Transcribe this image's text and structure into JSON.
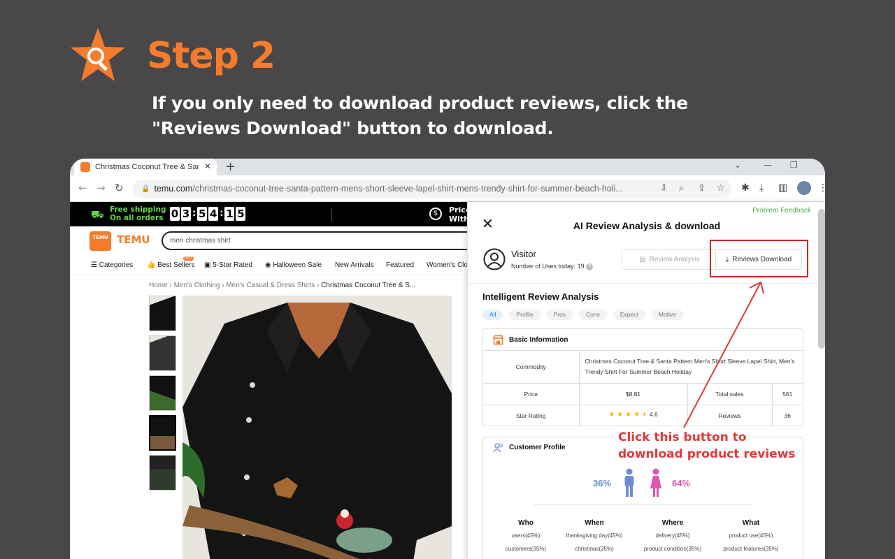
{
  "hero": {
    "step_label": "Step 2",
    "description": "If you only need to download product reviews, click the \"Reviews Download\" button to download."
  },
  "browser": {
    "tab_title": "Christmas Coconut Tree & Santa",
    "url_domain": "temu.com",
    "url_path": "/christmas-coconut-tree-santa-pattern-mens-short-sleeve-lapel-shirt-mens-trendy-shirt-for-summer-beach-holi..."
  },
  "temu": {
    "promo_line1": "Free shipping",
    "promo_line2": "On all orders",
    "timer_digits": [
      "0",
      "3",
      "5",
      "4",
      "1",
      "5"
    ],
    "price_line1": "Price",
    "price_line2": "With",
    "logo_box_text": "TEMU",
    "logo_text": "TEMU",
    "search_text": "men christmas shirt",
    "nav": {
      "categories": "Categories",
      "best_sellers": "Best Sellers",
      "hot_badge": "HOT",
      "five_star": "5-Star Rated",
      "halloween": "Halloween Sale",
      "new_arrivals": "New Arrivals",
      "featured": "Featured",
      "womens": "Women's Clot"
    },
    "breadcrumbs": {
      "home": "Home",
      "mens_clothing": "Men's Clothing",
      "casual": "Men's Casual & Dress Shirts",
      "current": "Christmas Coconut Tree & S..."
    }
  },
  "extension": {
    "feedback": "Problem Feedback",
    "title": "AI Review Analysis & download",
    "visitor_name": "Visitor",
    "uses_label": "Number of Uses today:",
    "uses_count": "19",
    "review_analysis_btn": "Review Analysis",
    "reviews_download_btn": "Reviews Download",
    "section_title": "Intelligent Review Analysis",
    "chips": [
      "All",
      "Profile",
      "Pros",
      "Cons",
      "Expect",
      "Motive"
    ],
    "basic_info": {
      "heading": "Basic Information",
      "commodity_label": "Commodity",
      "commodity_value": "Christmas Coconut Tree & Santa Pattern Men's Short Sleeve Lapel Shirt, Men's Trendy Shirt For Summer Beach Holiday",
      "price_label": "Price",
      "price_value": "$8.81",
      "total_sales_label": "Total sales",
      "total_sales_value": "561",
      "star_rating_label": "Star Rating",
      "star_rating_value": "4.6",
      "reviews_label": "Reviews",
      "reviews_value": "36"
    },
    "customer_profile": {
      "heading": "Customer Profile",
      "male_pct": "36%",
      "female_pct": "64%",
      "male_color": "#6d8fd1",
      "female_color": "#df55b2",
      "columns": [
        {
          "head": "Who",
          "items": [
            "users(45%)",
            "customers(35%)"
          ]
        },
        {
          "head": "When",
          "items": [
            "thanksgiving day(45%)",
            "christmas(35%)"
          ]
        },
        {
          "head": "Where",
          "items": [
            "delivery(45%)",
            "product condition(35%)"
          ]
        },
        {
          "head": "What",
          "items": [
            "product use(45%)",
            "product features(35%)"
          ]
        }
      ]
    }
  },
  "annotation": {
    "line1": "Click this button to",
    "line2": "download product reviews",
    "color": "#e03a3a"
  },
  "colors": {
    "background": "#4a4748",
    "accent": "#f57c2c",
    "highlight_box": "#c8272d"
  }
}
